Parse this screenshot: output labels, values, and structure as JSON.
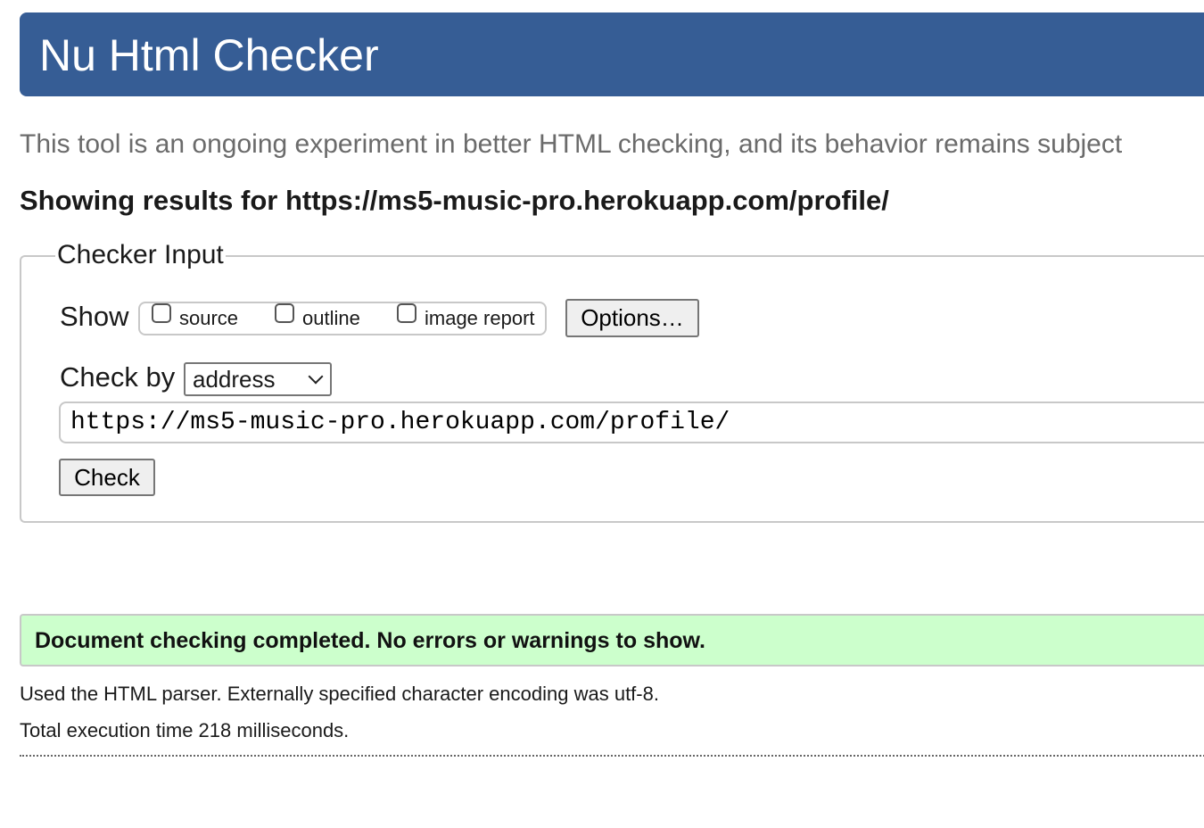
{
  "header": {
    "title": "Nu Html Checker",
    "background_color": "#365d95"
  },
  "intro": "This tool is an ongoing experiment in better HTML checking, and its behavior remains subject",
  "results_for": "Showing results for https://ms5-music-pro.herokuapp.com/profile/",
  "checker_input": {
    "legend": "Checker Input",
    "show_label": "Show",
    "checkboxes": [
      {
        "label": "source",
        "checked": false
      },
      {
        "label": "outline",
        "checked": false
      },
      {
        "label": "image report",
        "checked": false
      }
    ],
    "options_button": "Options…",
    "check_by_label": "Check by",
    "check_by_selected": "address",
    "url_value": "https://ms5-music-pro.herokuapp.com/profile/",
    "check_button": "Check"
  },
  "result": {
    "message": "Document checking completed. No errors or warnings to show.",
    "background_color": "#ccffcc"
  },
  "details": {
    "parser_info": "Used the HTML parser. Externally specified character encoding was utf-8.",
    "execution_time": "Total execution time 218 milliseconds."
  }
}
